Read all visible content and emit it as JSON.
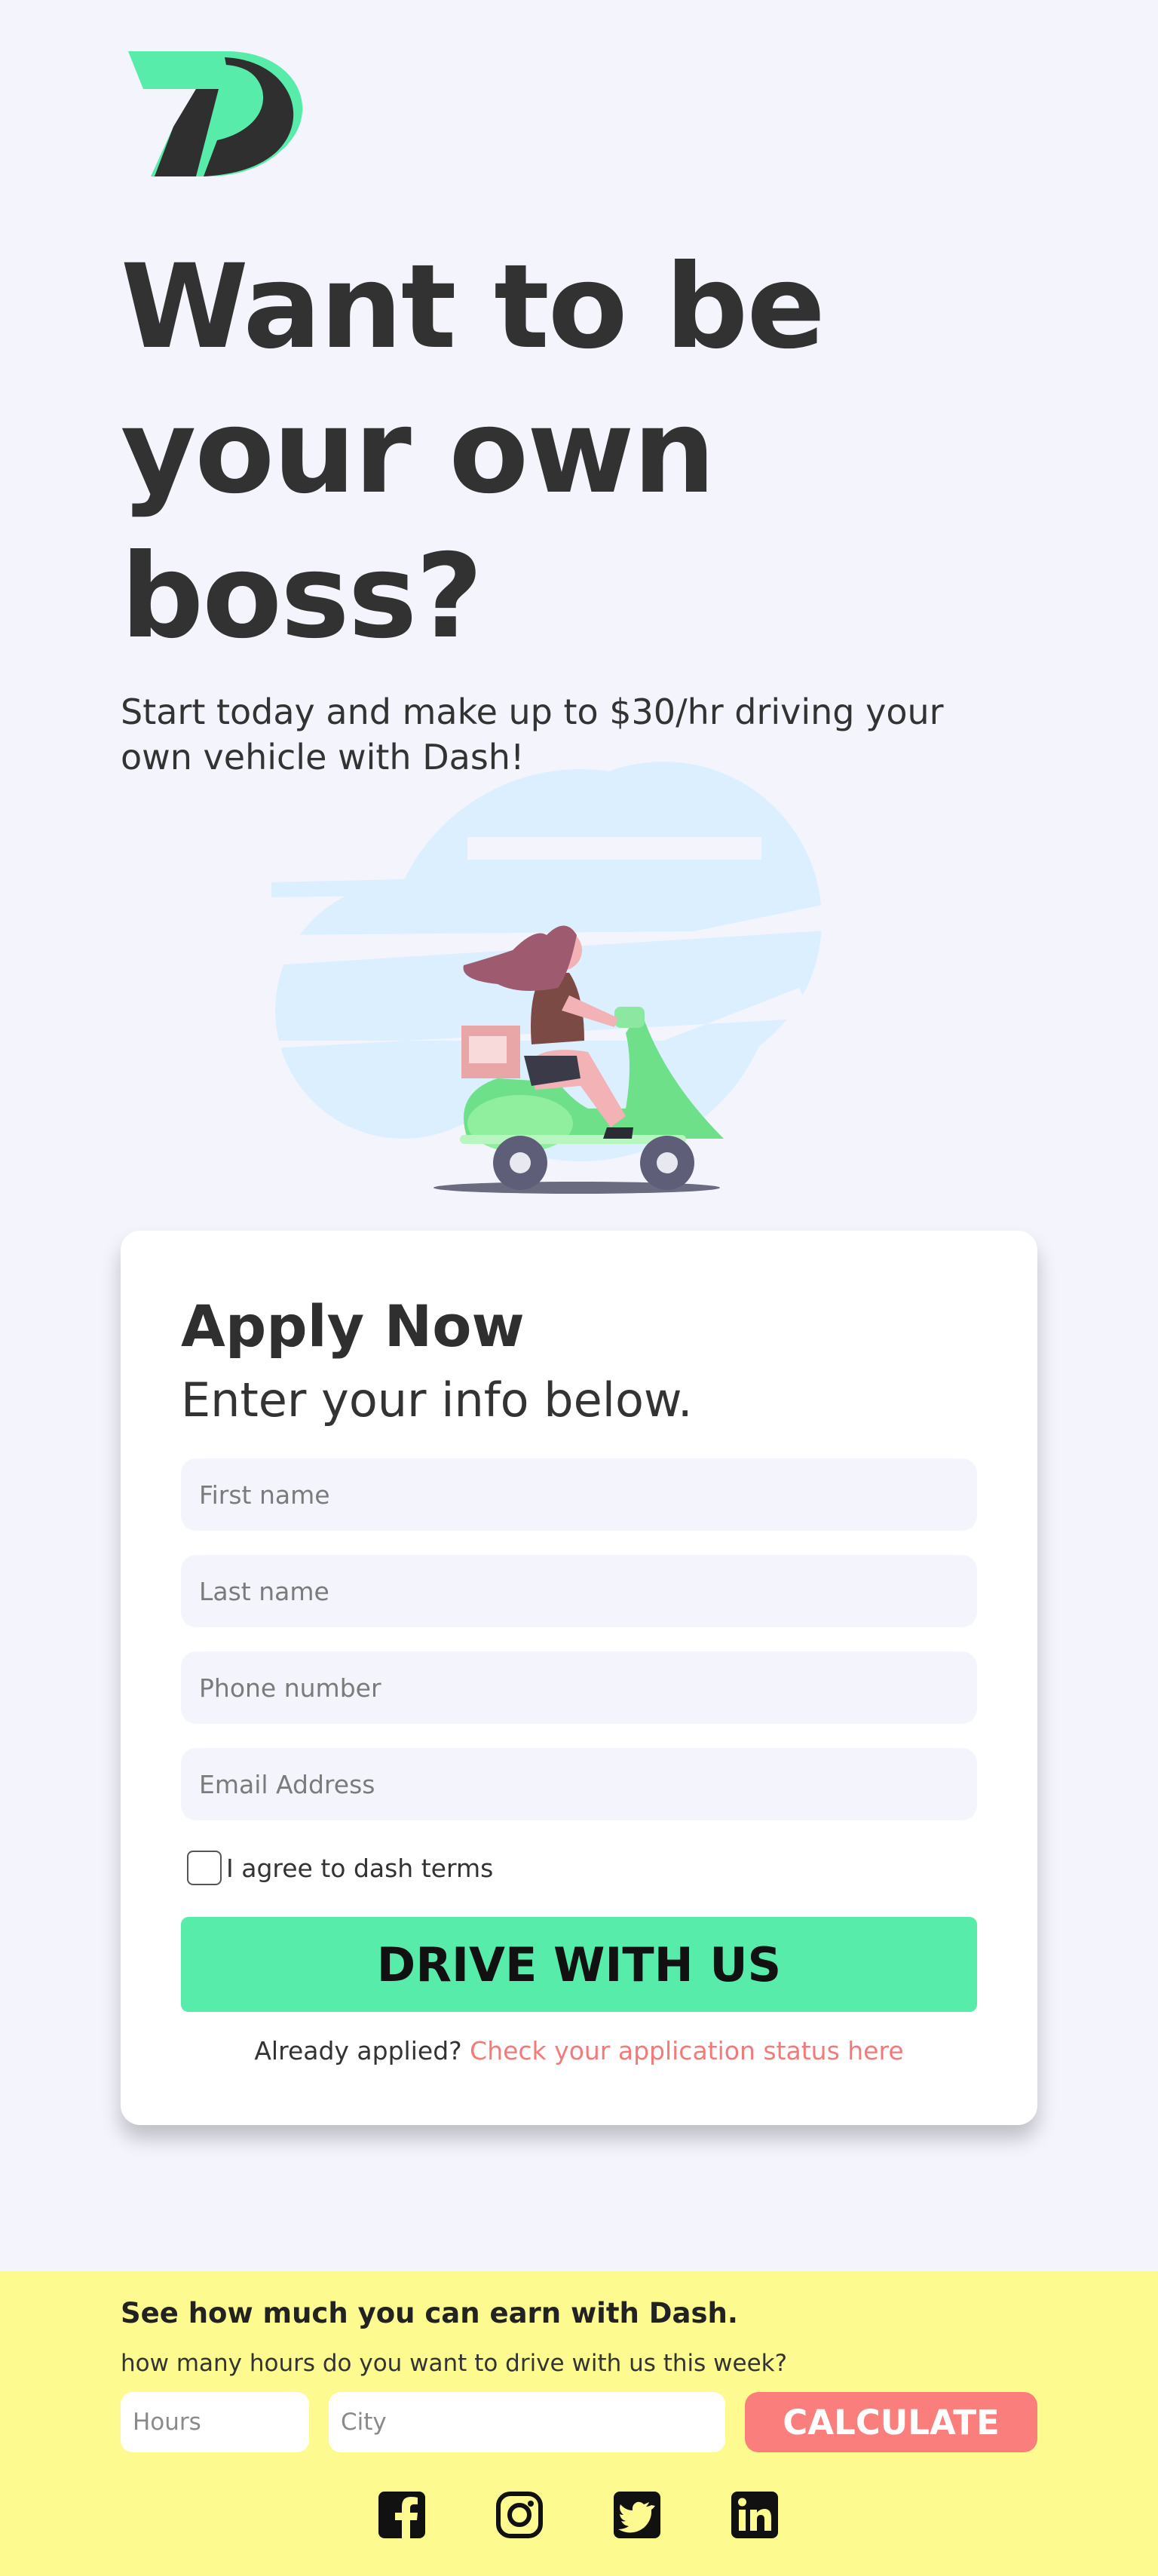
{
  "brand": {
    "logo_letter": "D",
    "accent": "#58ecab",
    "dark": "#2f2f2f"
  },
  "hero": {
    "title_line1": "Want to be",
    "title_line2": "your own",
    "title_line3": "boss?",
    "subtitle_line1": "Start today and make up to $30/hr driving your",
    "subtitle_line2": "own vehicle with Dash!"
  },
  "apply": {
    "title": "Apply Now",
    "subtitle": "Enter your info below.",
    "first_name_placeholder": "First name",
    "last_name_placeholder": "Last name",
    "phone_placeholder": "Phone number",
    "email_placeholder": "Email Address",
    "agree_label": "I agree to dash terms",
    "submit_label": "DRIVE WITH US",
    "already_text": "Already applied?",
    "status_link": "Check your application status here"
  },
  "earn": {
    "title": "See how much you can earn with Dash.",
    "question": "how many hours do you want to drive with us this week?",
    "hours_placeholder": "Hours",
    "city_placeholder": "City",
    "calculate_label": "CALCULATE"
  },
  "social": {
    "icons": [
      "facebook-icon",
      "instagram-icon",
      "twitter-icon",
      "linkedin-icon"
    ]
  },
  "colors": {
    "page_bg": "#f4f4fd",
    "footer_bg": "#fdfa8f",
    "calculate_bg": "#fa7e7c",
    "link": "#f47a7a"
  }
}
